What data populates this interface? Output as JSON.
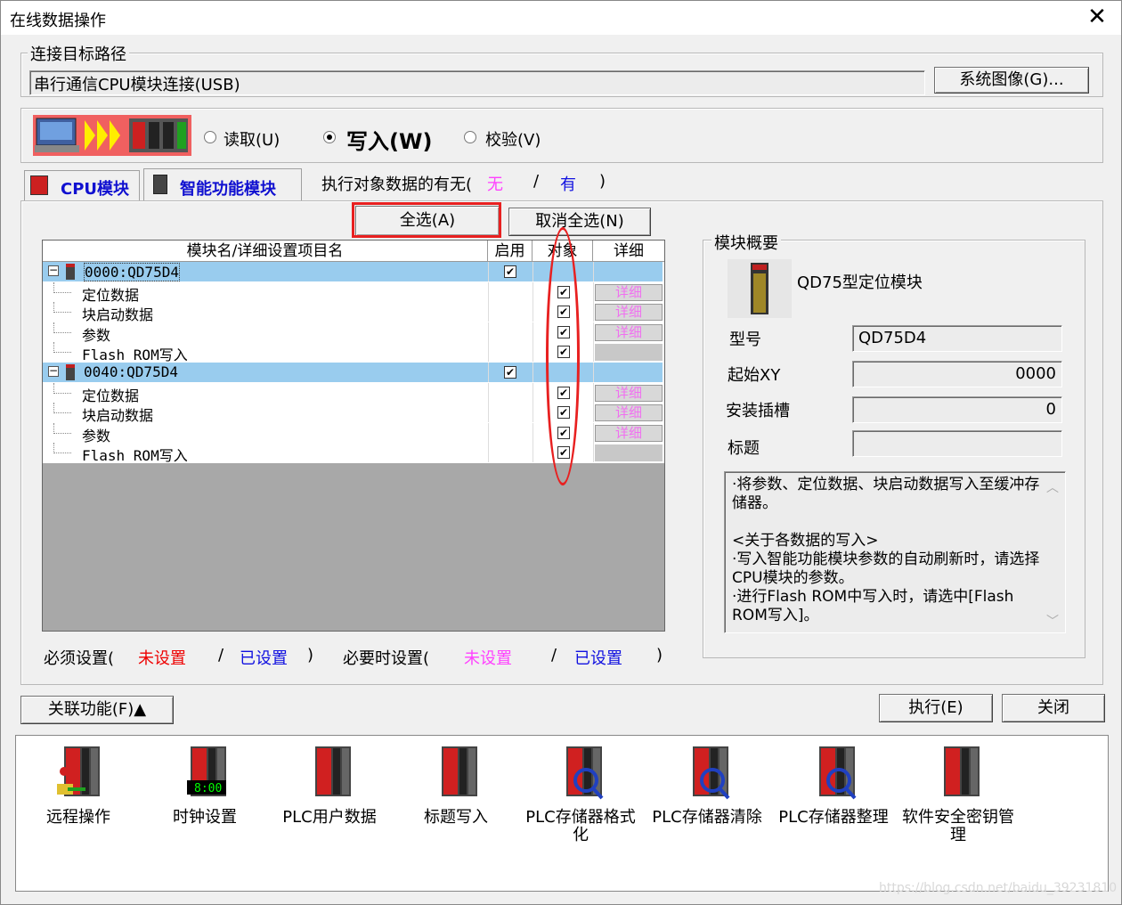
{
  "window": {
    "title": "在线数据操作",
    "close": "✕"
  },
  "path": {
    "group_label": "连接目标路径",
    "value": "串行通信CPU模块连接(USB)",
    "system_image_btn": "系统图像(G)..."
  },
  "mode": {
    "read": "读取(U)",
    "write": "写入(W)",
    "verify": "校验(V)",
    "selected": "write"
  },
  "tabs": {
    "cpu": "CPU模块",
    "intelligent": "智能功能模块",
    "exec_presence_prefix": "执行对象数据的有无(",
    "none": "无",
    "slash": "/",
    "has": "有",
    "close_paren": ")"
  },
  "buttons": {
    "select_all": "全选(A)",
    "deselect_all": "取消全选(N)",
    "related": "关联功能(F)▲",
    "execute": "执行(E)",
    "close": "关闭"
  },
  "grid": {
    "headers": {
      "name": "模块名/详细设置项目名",
      "enable": "启用",
      "target": "对象",
      "detail": "详细"
    },
    "rows": [
      {
        "name": "0000:QD75D4",
        "type": "module",
        "enable": true,
        "target": false,
        "detail": ""
      },
      {
        "name": "定位数据",
        "type": "item",
        "enable": false,
        "target": true,
        "detail": "详细"
      },
      {
        "name": "块启动数据",
        "type": "item",
        "enable": false,
        "target": true,
        "detail": "详细"
      },
      {
        "name": "参数",
        "type": "item",
        "enable": false,
        "target": true,
        "detail": "详细"
      },
      {
        "name": "Flash ROM写入",
        "type": "item",
        "enable": false,
        "target": true,
        "detail": ""
      },
      {
        "name": "0040:QD75D4",
        "type": "module",
        "enable": true,
        "target": false,
        "detail": ""
      },
      {
        "name": "定位数据",
        "type": "item",
        "enable": false,
        "target": true,
        "detail": "详细"
      },
      {
        "name": "块启动数据",
        "type": "item",
        "enable": false,
        "target": true,
        "detail": "详细"
      },
      {
        "name": "参数",
        "type": "item",
        "enable": false,
        "target": true,
        "detail": "详细"
      },
      {
        "name": "Flash ROM写入",
        "type": "item",
        "enable": false,
        "target": true,
        "detail": ""
      }
    ]
  },
  "legend": {
    "required_prefix": "必须设置(",
    "unset": "未设置",
    "slash": "/",
    "set": "已设置",
    "paren": ")",
    "optional_prefix": "必要时设置("
  },
  "summary": {
    "group_label": "模块概要",
    "module_name": "QD75型定位模块",
    "model_label": "型号",
    "model_value": "QD75D4",
    "start_label": "起始XY",
    "start_value": "0000",
    "slot_label": "安装插槽",
    "slot_value": "0",
    "title_label": "标题",
    "title_value": "",
    "note": "·将参数、定位数据、块启动数据写入至缓冲存储器。\n\n<关于各数据的写入>\n·写入智能功能模块参数的自动刷新时，请选择CPU模块的参数。\n·进行Flash ROM中写入时，请选中[Flash ROM写入]。"
  },
  "functions": [
    {
      "label": "远程操作",
      "icon": "remote-operation-icon"
    },
    {
      "label": "时钟设置",
      "icon": "clock-setting-icon",
      "clock": "8:00"
    },
    {
      "label": "PLC用户数据",
      "icon": "plc-user-data-icon"
    },
    {
      "label": "标题写入",
      "icon": "title-write-icon"
    },
    {
      "label": "PLC存储器格式化",
      "icon": "plc-memory-format-icon"
    },
    {
      "label": "PLC存储器清除",
      "icon": "plc-memory-clear-icon"
    },
    {
      "label": "PLC存储器整理",
      "icon": "plc-memory-arrange-icon"
    },
    {
      "label": "软件安全密钥管理",
      "icon": "software-security-key-icon"
    }
  ],
  "watermark": "https://blog.csdn.net/baidu_39231810"
}
